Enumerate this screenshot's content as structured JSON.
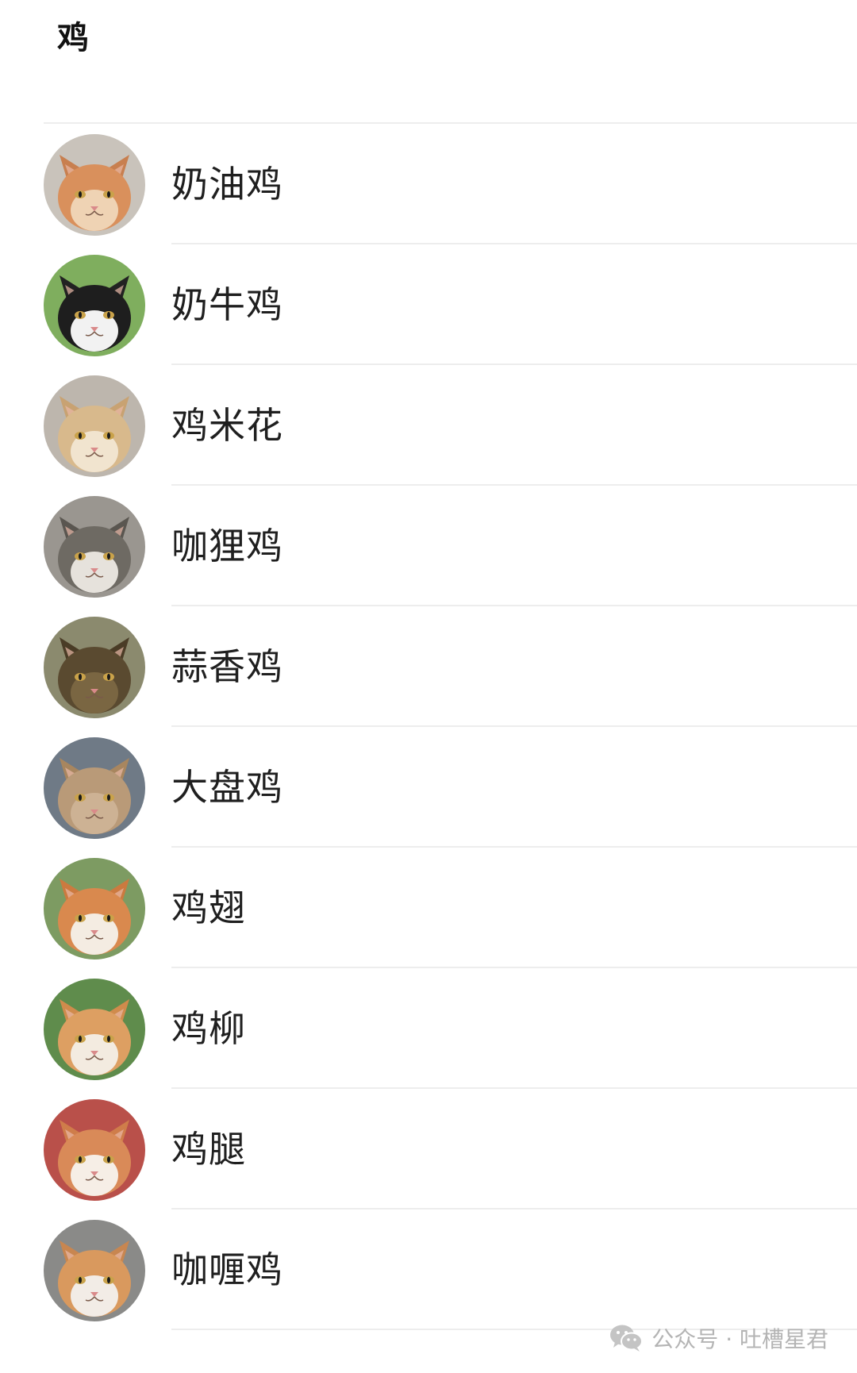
{
  "header": {
    "title": "鸡"
  },
  "contacts": [
    {
      "name": "奶油鸡",
      "avatar": "cat-orange-white-avatar",
      "fur": "#d9905c",
      "face": "#efd3b4",
      "bg": "#c9c3bb",
      "ear": "#c87f4f"
    },
    {
      "name": "奶牛鸡",
      "avatar": "cat-black-white-avatar",
      "fur": "#1e1e1e",
      "face": "#f2f2f2",
      "bg": "#7fae5e",
      "ear": "#222222"
    },
    {
      "name": "鸡米花",
      "avatar": "cat-cream-avatar",
      "fur": "#d8b98c",
      "face": "#f1e4cf",
      "bg": "#bdb6ad",
      "ear": "#c8a272"
    },
    {
      "name": "咖狸鸡",
      "avatar": "cat-grey-tabby-avatar",
      "fur": "#6e6a63",
      "face": "#e6e2dc",
      "bg": "#9a9690",
      "ear": "#5a5650"
    },
    {
      "name": "蒜香鸡",
      "avatar": "cat-brown-tabby-avatar",
      "fur": "#5a4a30",
      "face": "#7a6642",
      "bg": "#8b8a6e",
      "ear": "#4a3c26"
    },
    {
      "name": "大盘鸡",
      "avatar": "cat-fluffy-orange-avatar",
      "fur": "#b99a78",
      "face": "#cdb294",
      "bg": "#6f7a86",
      "ear": "#a8865f"
    },
    {
      "name": "鸡翅",
      "avatar": "cat-orange-white-avatar-2",
      "fur": "#d9894e",
      "face": "#f4ece2",
      "bg": "#7d9b62",
      "ear": "#cc7a3f"
    },
    {
      "name": "鸡柳",
      "avatar": "cat-orange-white-avatar-3",
      "fur": "#dd9f62",
      "face": "#f3ebe0",
      "bg": "#5f8c4c",
      "ear": "#d08b4c"
    },
    {
      "name": "鸡腿",
      "avatar": "cat-orange-white-avatar-4",
      "fur": "#d98a58",
      "face": "#f6eee6",
      "bg": "#b9504a",
      "ear": "#cf7d4a"
    },
    {
      "name": "咖喱鸡",
      "avatar": "cat-orange-white-avatar-5",
      "fur": "#d9995e",
      "face": "#f2ece6",
      "bg": "#8a8a88",
      "ear": "#c88650"
    }
  ],
  "watermark": {
    "icon": "wechat-icon",
    "text": "公众号 · 吐槽星君"
  }
}
